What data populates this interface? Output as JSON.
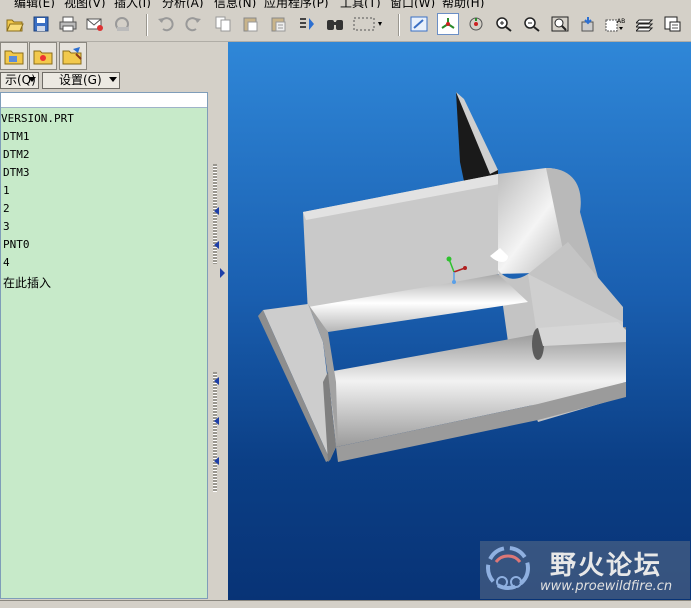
{
  "menu": {
    "items": [
      "编辑(E)",
      "视图(V)",
      "插入(I)",
      "分析(A)",
      "信息(N)",
      "应用程序(P)",
      "工具(T)",
      "窗口(W)",
      "帮助(H)"
    ]
  },
  "toolbar": {
    "icons": [
      "open-icon",
      "save-icon",
      "print-icon",
      "email-icon",
      "email-link-icon",
      "undo-icon",
      "redo-icon",
      "copy-icon",
      "paste-icon",
      "paste-special-icon",
      "regenerate-icon",
      "find-icon",
      "select-box-icon",
      "view-display-icon",
      "spin-center-icon",
      "spin-center-orbit-icon",
      "zoom-in-icon",
      "zoom-out-icon",
      "refit-icon",
      "reorient-icon",
      "saved-views-icon",
      "layers-icon",
      "model-tree-icon"
    ]
  },
  "navigator": {
    "show_dropdown": "示(Q)",
    "settings_dropdown": "设置(G)"
  },
  "model_tree": {
    "items": [
      "VERSION.PRT",
      "DTM1",
      "DTM2",
      "DTM3",
      "1",
      "2",
      "3",
      "PNT0",
      "4",
      "在此插入"
    ]
  },
  "watermark": {
    "title": "野火论坛",
    "url": "www.proewildfire.cn"
  },
  "colors": {
    "tree_bg": "#c7eac9",
    "viewport_top": "#2f87d8",
    "viewport_bottom": "#083376",
    "model_gray": "#c8c8c8"
  }
}
